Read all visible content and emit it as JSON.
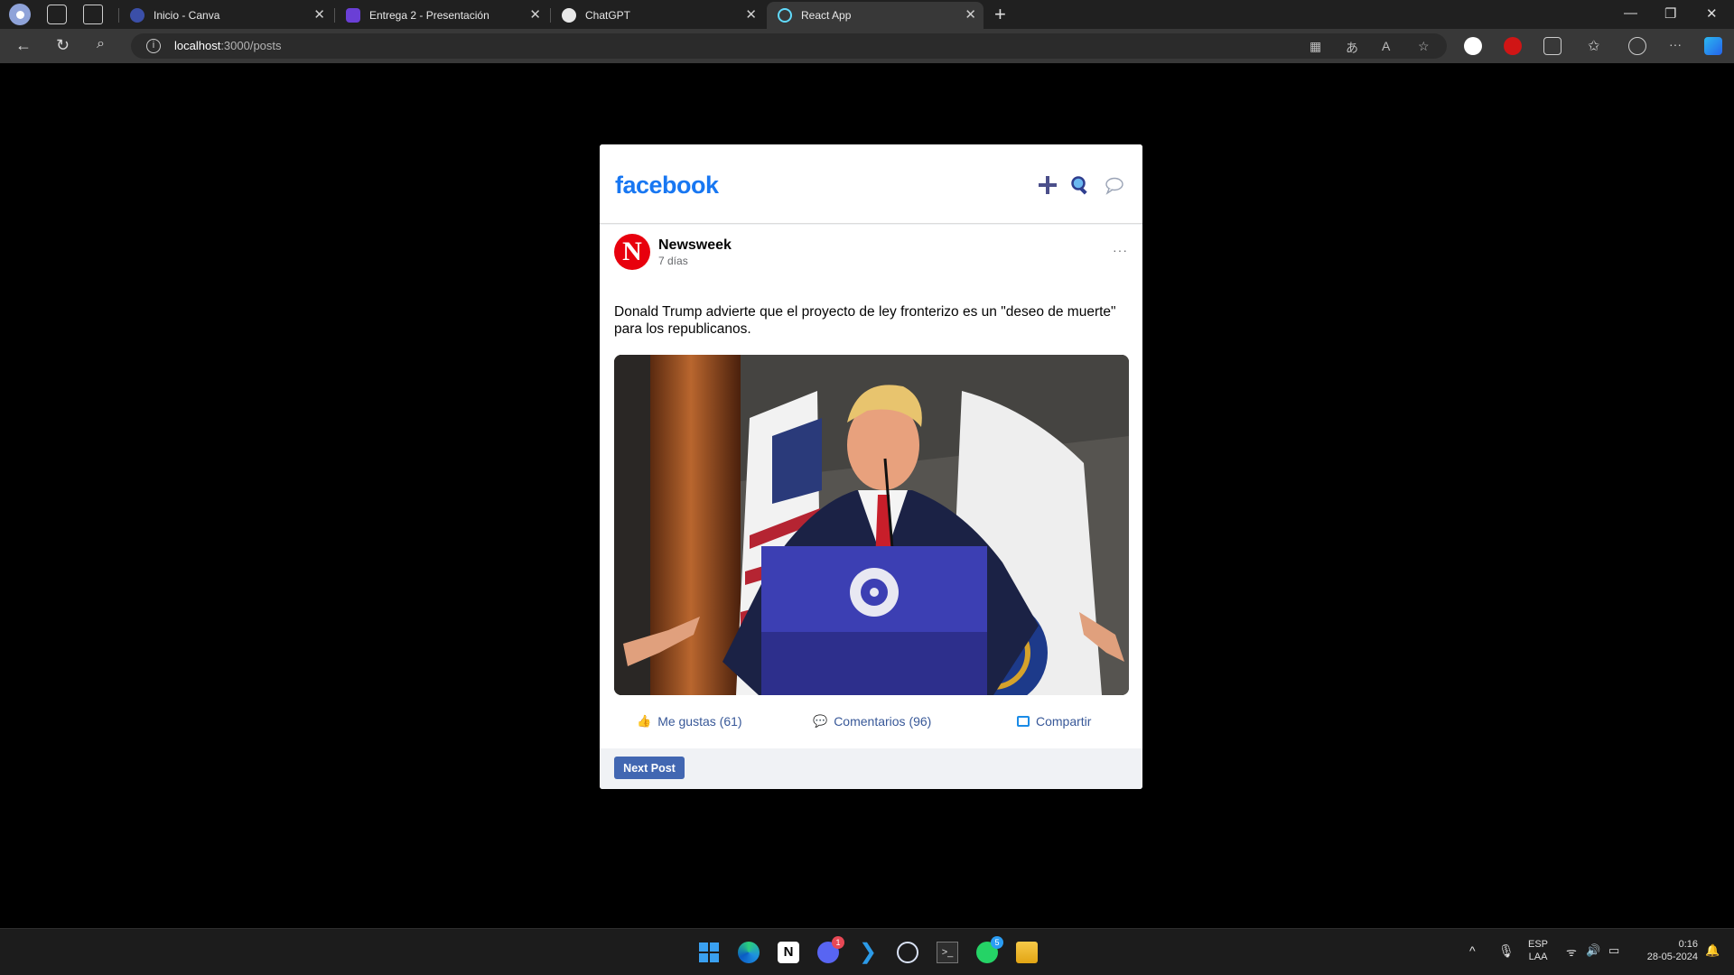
{
  "browser": {
    "tabs": [
      {
        "title": "Inicio - Canva",
        "favicon_color": "#3b4fa8"
      },
      {
        "title": "Entrega 2 - Presentación",
        "favicon_color": "#6a3fd6"
      },
      {
        "title": "ChatGPT",
        "favicon_color": "#e8e8e8"
      },
      {
        "title": "React App",
        "favicon_color": "#61dafb"
      }
    ],
    "active_tab_index": 3,
    "url_host": "localhost",
    "url_path": ":3000/posts"
  },
  "page": {
    "logo": "facebook",
    "header_icons": [
      "plus-icon",
      "search-icon",
      "chat-bubble-icon"
    ],
    "post": {
      "author": "Newsweek",
      "avatar_letter": "N",
      "time": "7 días",
      "more": "···",
      "text": "Donald Trump advierte que el proyecto de ley fronterizo es un \"deseo de muerte\" para los republicanos.",
      "actions": {
        "like_label": "Me gustas (61)",
        "comment_label": "Comentarios (96)",
        "share_label": "Compartir"
      }
    },
    "next_button": "Next Post"
  },
  "taskbar": {
    "apps": [
      "windows-start",
      "edge",
      "notion",
      "discord",
      "vscode",
      "app-launcher",
      "terminal",
      "whatsapp",
      "file-explorer"
    ],
    "discord_badge": "1",
    "whatsapp_badge": "5",
    "lang_top": "ESP",
    "lang_bottom": "LAA",
    "time": "0:16",
    "date": "28-05-2024"
  },
  "colors": {
    "facebook_blue": "#1877f2",
    "button_blue": "#4267b2",
    "link_blue": "#385898",
    "newsweek_red": "#e8000d"
  }
}
